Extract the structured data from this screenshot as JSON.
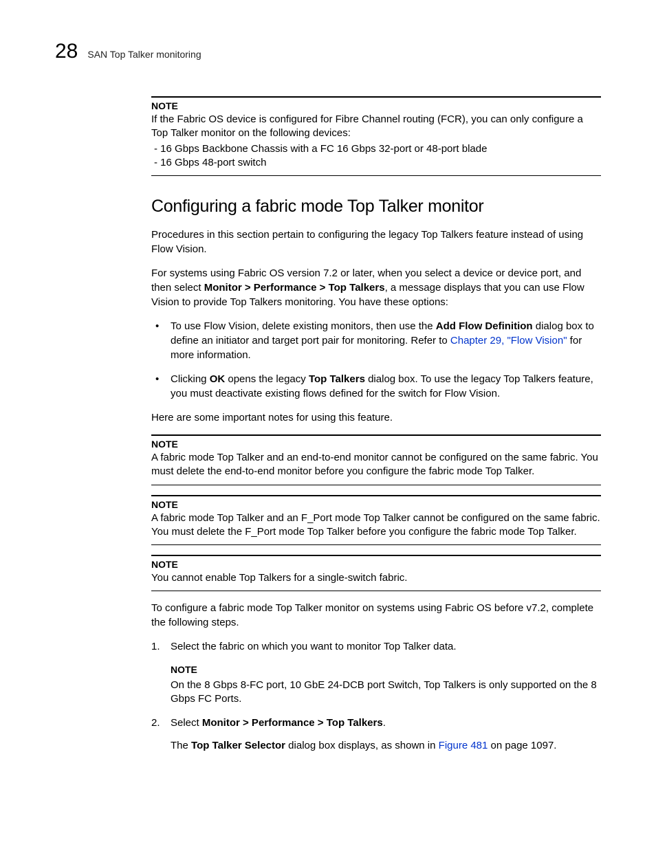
{
  "header": {
    "page_number": "28",
    "running_title": "SAN Top Talker monitoring"
  },
  "note1": {
    "label": "NOTE",
    "body": "If the Fabric OS device is configured for Fibre Channel routing (FCR), you can only configure a Top Talker monitor on the following devices:",
    "items": [
      "16 Gbps Backbone Chassis with a FC 16 Gbps 32-port or 48-port blade",
      "16 Gbps 48-port switch"
    ]
  },
  "section_title": "Configuring a fabric mode Top Talker monitor",
  "p_intro": "Procedures in this section pertain to configuring the legacy Top Talkers feature instead of using Flow Vision.",
  "p_systems_pre": "For systems using Fabric OS version 7.2 or later, when you select a device or device port, and then select ",
  "p_systems_bold": "Monitor > Performance > Top Talkers",
  "p_systems_post": ", a message displays that you can use Flow Vision to provide Top Talkers monitoring. You have these options:",
  "bullets": {
    "b1_pre": "To use Flow Vision, delete existing monitors, then use the ",
    "b1_bold": "Add Flow Definition",
    "b1_mid": " dialog box to define an initiator and target port pair for monitoring. Refer to ",
    "b1_link": "Chapter 29, \"Flow Vision\"",
    "b1_post": " for more information.",
    "b2_pre": "Clicking ",
    "b2_ok": "OK",
    "b2_mid": " opens the legacy ",
    "b2_tt": "Top Talkers",
    "b2_post": " dialog box. To use the legacy Top Talkers feature, you must deactivate existing flows defined for the switch for Flow Vision."
  },
  "p_notes_intro": "Here are some important notes for using this feature.",
  "note2": {
    "label": "NOTE",
    "body": "A fabric mode Top Talker and an end-to-end monitor cannot be configured on the same fabric. You must delete the end-to-end monitor before you configure the fabric mode Top Talker."
  },
  "note3": {
    "label": "NOTE",
    "body": "A fabric mode Top Talker and an F_Port mode Top Talker cannot be configured on the same fabric. You must delete the F_Port mode Top Talker before you configure the fabric mode Top Talker."
  },
  "note4": {
    "label": "NOTE",
    "body": "You cannot enable Top Talkers for a single-switch fabric."
  },
  "p_configure": "To configure a fabric mode Top Talker monitor on systems using Fabric OS before v7.2, complete the following steps.",
  "steps": {
    "s1": "Select the fabric on which you want to monitor Top Talker data.",
    "s1_note_label": "NOTE",
    "s1_note_body": "On the 8 Gbps 8-FC port, 10 GbE 24-DCB port Switch, Top Talkers is only supported on the 8 Gbps FC Ports.",
    "s2_pre": "Select ",
    "s2_bold": "Monitor > Performance > Top Talkers",
    "s2_post": ".",
    "s2_body_pre": "The ",
    "s2_body_bold": "Top Talker Selector",
    "s2_body_mid": " dialog box displays, as shown in ",
    "s2_body_link": "Figure 481",
    "s2_body_post": " on page 1097."
  }
}
